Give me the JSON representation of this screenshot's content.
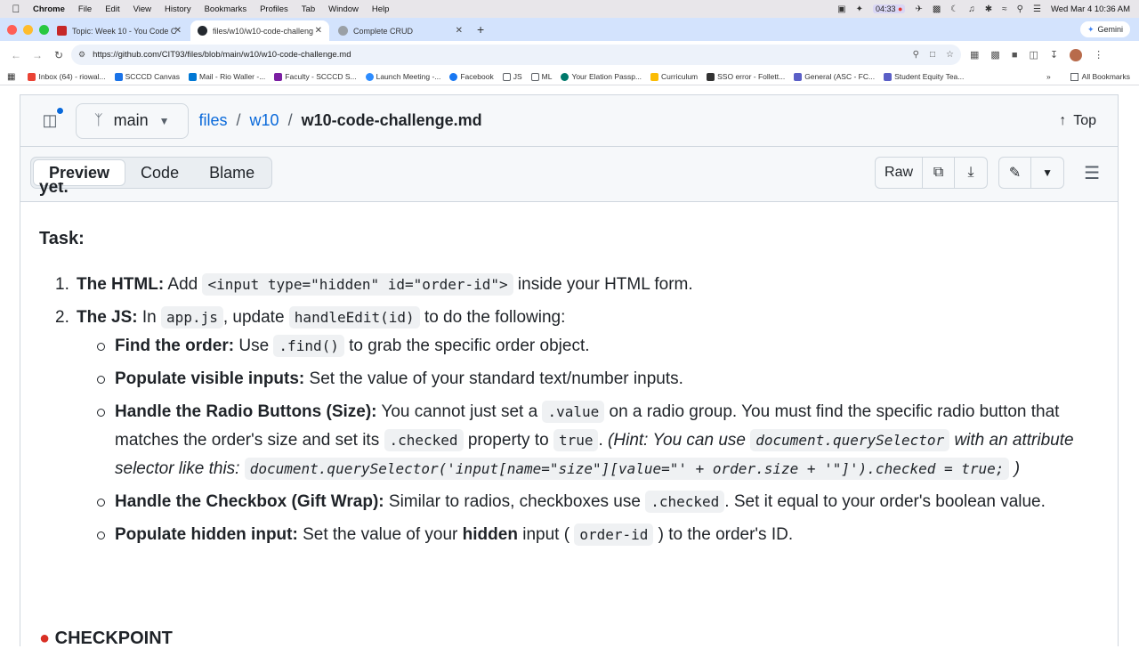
{
  "menubar": {
    "app": "Chrome",
    "items": [
      "File",
      "Edit",
      "View",
      "History",
      "Bookmarks",
      "Profiles",
      "Tab",
      "Window",
      "Help"
    ],
    "timer": "04:33",
    "datetime": "Wed Mar 4  10:36 AM"
  },
  "tabs": [
    {
      "title": "Topic: Week 10 - You Code C",
      "color": "#c62828"
    },
    {
      "title": "files/w10/w10-code-challeng",
      "color": "#24292f"
    },
    {
      "title": "Complete CRUD",
      "color": "#9aa0a6"
    }
  ],
  "gemini_label": "Gemini",
  "address": {
    "url": "https://github.com/CIT93/files/blob/main/w10/w10-code-challenge.md"
  },
  "bookmarks": [
    {
      "label": "Inbox (64) - riowal...",
      "color": "#ea4335"
    },
    {
      "label": "SCCCD Canvas",
      "color": "#1a73e8"
    },
    {
      "label": "Mail - Rio Waller -...",
      "color": "#0078d4"
    },
    {
      "label": "Faculty - SCCCD S...",
      "color": "#7b1fa2"
    },
    {
      "label": "Launch Meeting -...",
      "color": "#2d8cff"
    },
    {
      "label": "Facebook",
      "color": "#1877f2"
    },
    {
      "label": "JS",
      "color": "#5f6368"
    },
    {
      "label": "ML",
      "color": "#5f6368"
    },
    {
      "label": "Your Elation Passp...",
      "color": "#00796b"
    },
    {
      "label": "Curriculum",
      "color": "#fbbc04"
    },
    {
      "label": "SSO error - Follett...",
      "color": "#333333"
    },
    {
      "label": "General (ASC - FC...",
      "color": "#5b5fc7"
    },
    {
      "label": "Student Equity Tea...",
      "color": "#5b5fc7"
    }
  ],
  "all_bookmarks": "All Bookmarks",
  "repo": {
    "branch": "main",
    "crumb_root": "files",
    "crumb_dir": "w10",
    "crumb_file": "w10-code-challenge.md",
    "sep": "/",
    "top": "Top"
  },
  "file_tabs": {
    "preview": "Preview",
    "code": "Code",
    "blame": "Blame"
  },
  "raw_label": "Raw",
  "md": {
    "clipped_text": "yet.",
    "task_heading": "Task:",
    "s1": {
      "num": "1.",
      "label": "The HTML:",
      "t1": "Add",
      "code1": "<input type=\"hidden\" id=\"order-id\">",
      "t2": "inside your HTML form."
    },
    "s2": {
      "num": "2.",
      "label": "The JS:",
      "t1": "In",
      "code1": "app.js",
      "t2": ", update",
      "code2": "handleEdit(id)",
      "t3": "to do the following:"
    },
    "b1": {
      "label": "Find the order:",
      "t1": "Use",
      "code1": ".find()",
      "t2": "to grab the specific order object."
    },
    "b2": {
      "label": "Populate visible inputs:",
      "t1": "Set the value of your standard text/number inputs."
    },
    "b3": {
      "label": "Handle the Radio Buttons (Size):",
      "t1": "You cannot just set a",
      "code1": ".value",
      "t2": "on a radio group. You must find the specific radio button that matches the order's size and set its",
      "code2": ".checked",
      "t3": "property to",
      "code3": "true",
      "t4": ".",
      "hint1": "(Hint: You can use",
      "code4": "document.querySelector",
      "hint2": "with an attribute selector like this:",
      "code5": "document.querySelector('input[name=\"size\"][value=\"' + order.size + '\"]').checked = true;",
      "hint3": ")"
    },
    "b4": {
      "label": "Handle the Checkbox (Gift Wrap):",
      "t1": "Similar to radios, checkboxes use",
      "code1": ".checked",
      "t2": ". Set it equal to your order's boolean value."
    },
    "b5": {
      "label": "Populate hidden input:",
      "t1": "Set the value of your",
      "bold1": "hidden",
      "t2": "input (",
      "code1": "order-id",
      "t3": ") to the order's ID."
    },
    "checkpoint": "CHECKPOINT"
  }
}
